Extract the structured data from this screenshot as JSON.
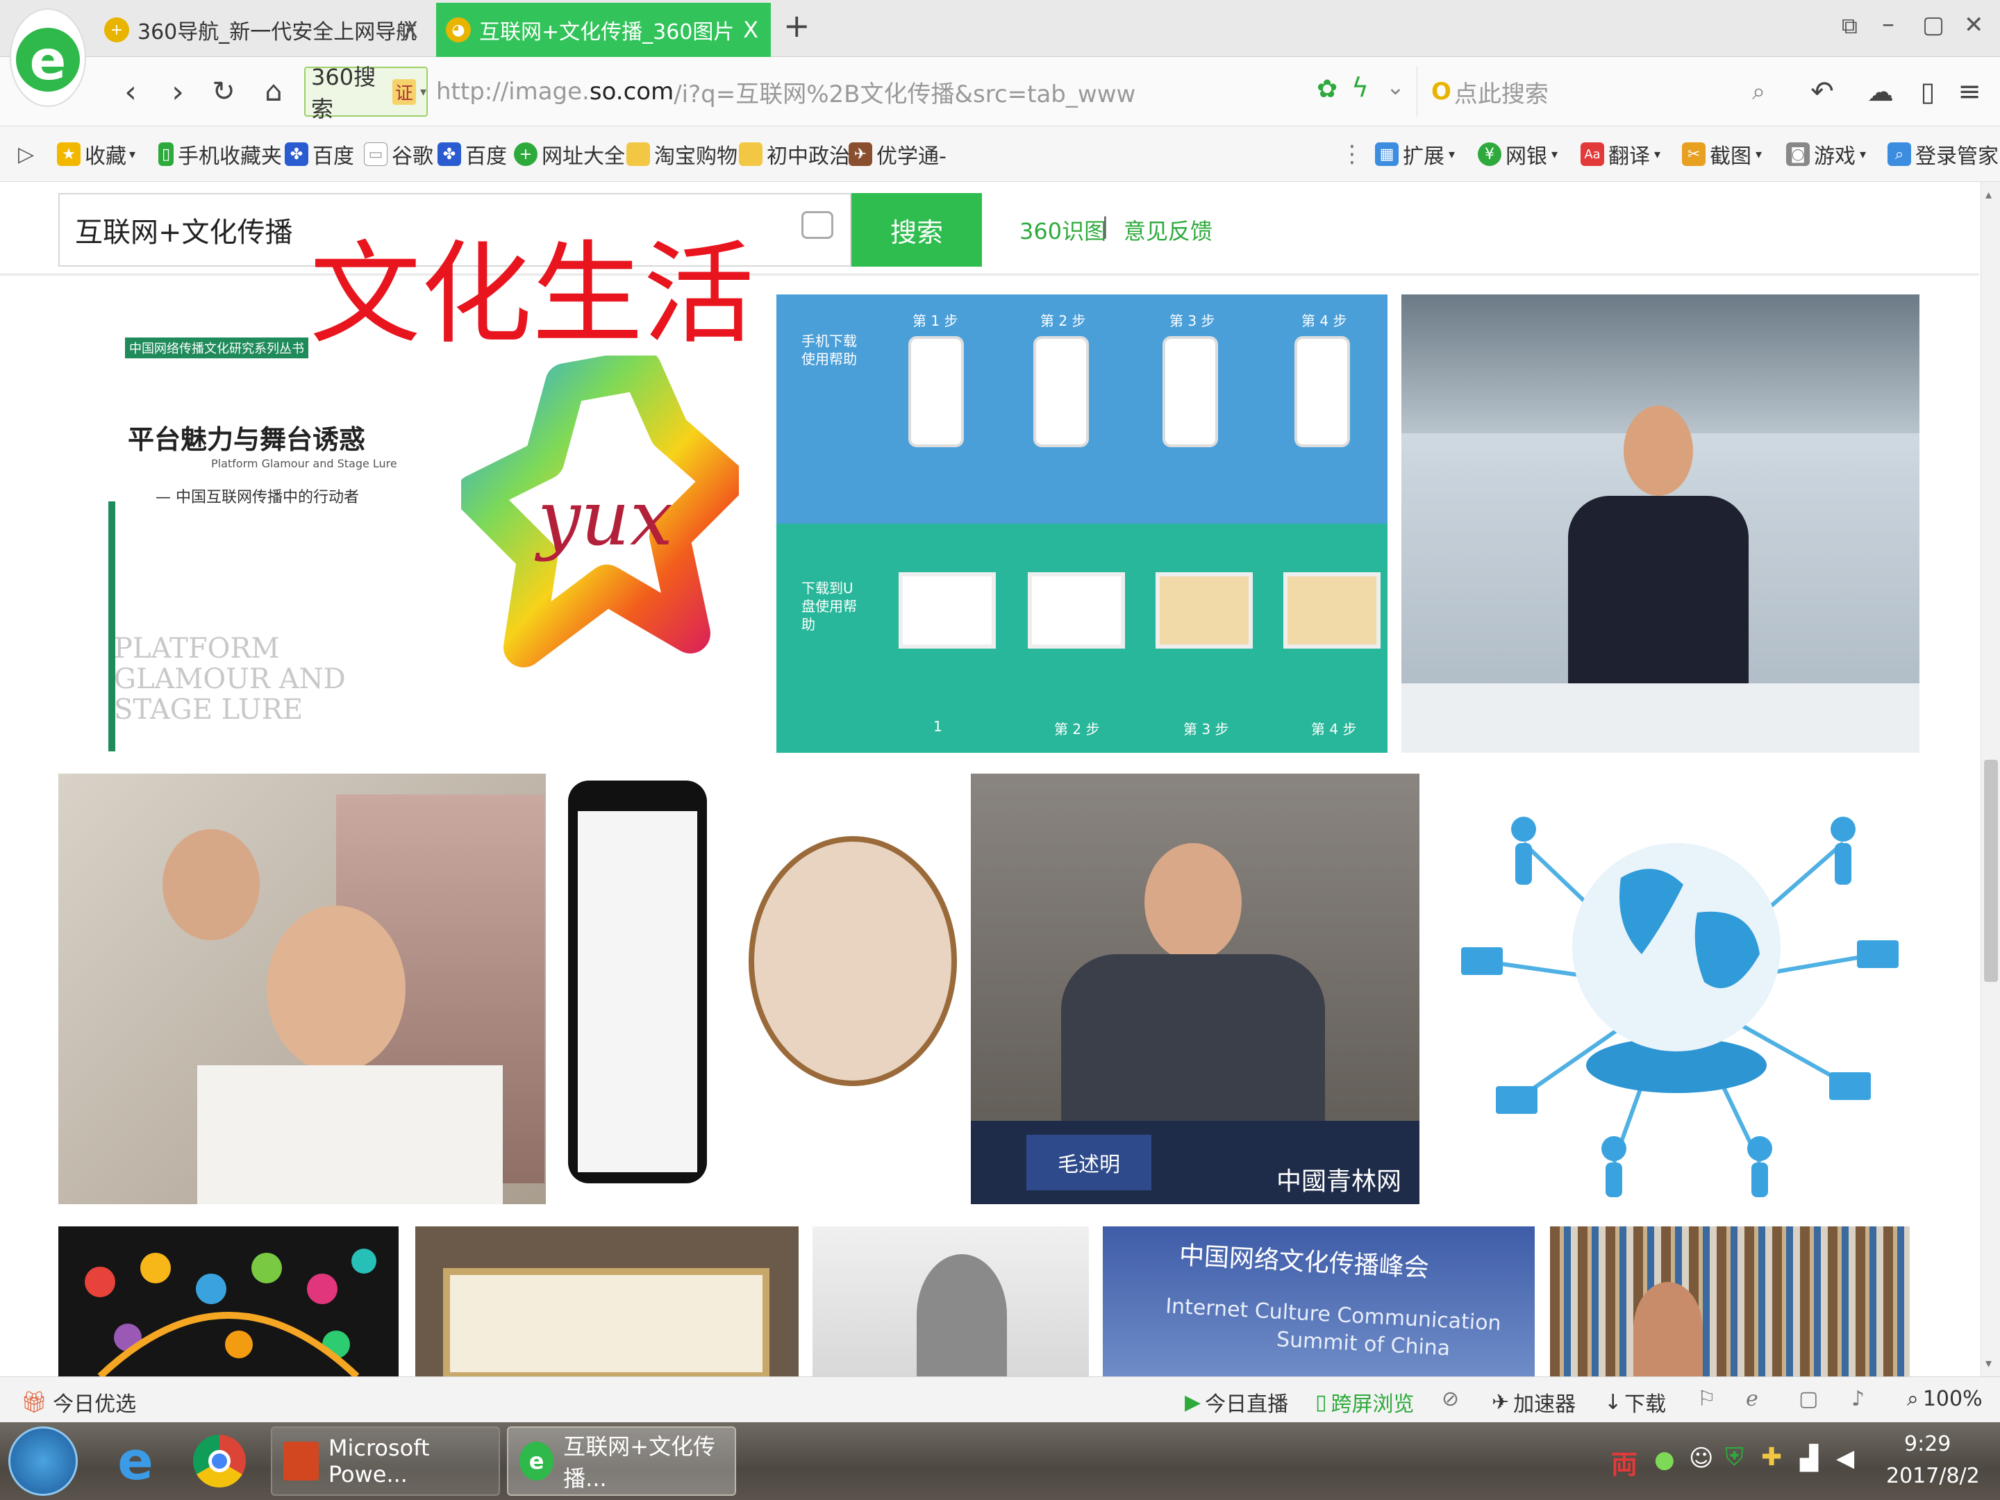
{
  "tabs": [
    {
      "label": "360导航_新一代安全上网导航",
      "active": false,
      "close": "X"
    },
    {
      "label": "互联网+文化传播_360图片",
      "active": true,
      "close": "X"
    }
  ],
  "new_tab": "+",
  "window_controls": {
    "restore": "⧉",
    "minimize": "–",
    "maximize": "▢",
    "close": "✕"
  },
  "nav": {
    "search_engine": "360搜索",
    "cert_badge": "证",
    "url_prefix": "http://image.",
    "url_domain": "so.com",
    "url_rest": "/i?q=互联网%2B文化传播&src=tab_www",
    "side_search_placeholder": "点此搜索"
  },
  "bookmarks": [
    {
      "label": "收藏",
      "icon": "star-icon"
    },
    {
      "label": "手机收藏夹",
      "icon": "phone-icon"
    },
    {
      "label": "百度",
      "icon": "paw-icon"
    },
    {
      "label": "谷歌",
      "icon": "page-icon"
    },
    {
      "label": "百度",
      "icon": "paw-icon"
    },
    {
      "label": "网址大全",
      "icon": "globe-icon"
    },
    {
      "label": "淘宝购物",
      "icon": "folder-icon"
    },
    {
      "label": "初中政治",
      "icon": "folder-icon"
    },
    {
      "label": "优学通-",
      "icon": "bird-icon"
    }
  ],
  "toolbar_right": [
    {
      "label": "扩展"
    },
    {
      "label": "网银"
    },
    {
      "label": "翻译"
    },
    {
      "label": "截图"
    },
    {
      "label": "游戏"
    },
    {
      "label": "登录管家"
    }
  ],
  "search": {
    "query": "互联网+文化传播",
    "button": "搜索",
    "shitu": "360识图",
    "separator": "|",
    "feedback": "意见反馈"
  },
  "overlay_title": "文化生活",
  "images": {
    "book_title": "平台魅力与舞台诱惑",
    "book_subtitle_en": "Platform Glamour and Stage Lure",
    "book_line2": "— 中国互联网传播中的行动者",
    "book_bottom": "PLATFORM GLAMOUR AND STAGE LURE",
    "book_series": "中国网络传播文化研究系列丛书",
    "yux": "yux",
    "help_step_prefix": "第",
    "help_step_suffix": "步",
    "help_phone": "手机下载使用帮助",
    "help_usb": "下载到U盘使用帮助",
    "mao_name": "毛述明",
    "watermark": "中國青林网",
    "summit_cn": "中国网络文化传播峰会",
    "summit_en1": "Internet Culture Communication",
    "summit_en2": "Summit of China"
  },
  "status": {
    "today": "今日优选",
    "live": "今日直播",
    "cross": "跨屏浏览",
    "accel": "加速器",
    "download": "下载",
    "zoom": "100%"
  },
  "taskbar": {
    "ppt": "Microsoft Powe...",
    "browser": "互联网+文化传播...",
    "time": "9:29",
    "date": "2017/8/2"
  },
  "colors": {
    "accent_green": "#2eaa3c",
    "tab_active": "#32c45a",
    "overlay_red": "#e8141e"
  }
}
